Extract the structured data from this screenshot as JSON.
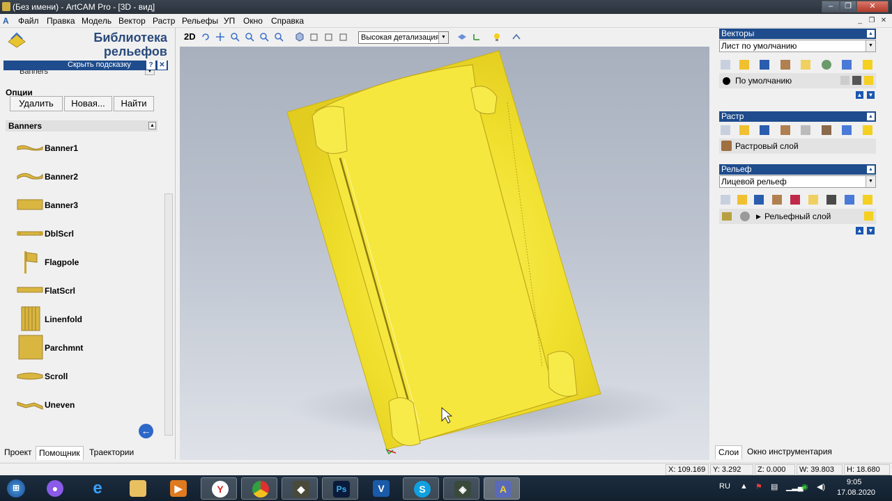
{
  "window": {
    "title": "(Без имени) - ArtCAM Pro - [3D - вид]"
  },
  "menu": [
    "Файл",
    "Правка",
    "Модель",
    "Вектор",
    "Растр",
    "Рельефы",
    "УП",
    "Окно",
    "Справка"
  ],
  "left_panel": {
    "title_line1": "Библиотека",
    "title_line2": "рельефов",
    "hint_label": "Скрыть подсказку",
    "hint_help": "?",
    "hint_close": "✕",
    "combo_value": "Banners",
    "options_label": "Опции",
    "buttons": {
      "delete": "Удалить",
      "new": "Новая...",
      "find": "Найти"
    },
    "group_header": "Banners",
    "items": [
      "Banner1",
      "Banner2",
      "Banner3",
      "DblScrl",
      "Flagpole",
      "FlatScrl",
      "Linenfold",
      "Parchmnt",
      "Scroll",
      "Uneven"
    ],
    "tabs": [
      "Проект",
      "Помощник",
      "Траектории"
    ],
    "active_tab": "Помощник"
  },
  "toolbar": {
    "mode_2d": "2D",
    "detail_select": "Высокая детализация"
  },
  "right_panel": {
    "vectors": {
      "header": "Векторы",
      "combo": "Лист по умолчанию",
      "layer": "По умолчанию"
    },
    "raster": {
      "header": "Растр",
      "layer": "Растровый слой"
    },
    "relief": {
      "header": "Рельеф",
      "combo": "Лицевой рельеф",
      "layer": "Рельефный слой"
    },
    "tabs": [
      "Слои",
      "Окно инструментария"
    ],
    "active_tab": "Слои"
  },
  "status": {
    "x": "X: 109.169",
    "y": "Y: 3.292",
    "z": "Z: 0.000",
    "w": "W: 39.803",
    "h": "H: 18.680"
  },
  "taskbar": {
    "lang": "RU",
    "time": "9:05",
    "date": "17.08.2020"
  },
  "colors": {
    "panel_header": "#1e4c8c",
    "relief_yellow": "#f2e233",
    "view_bg": "#bcc3cf"
  }
}
